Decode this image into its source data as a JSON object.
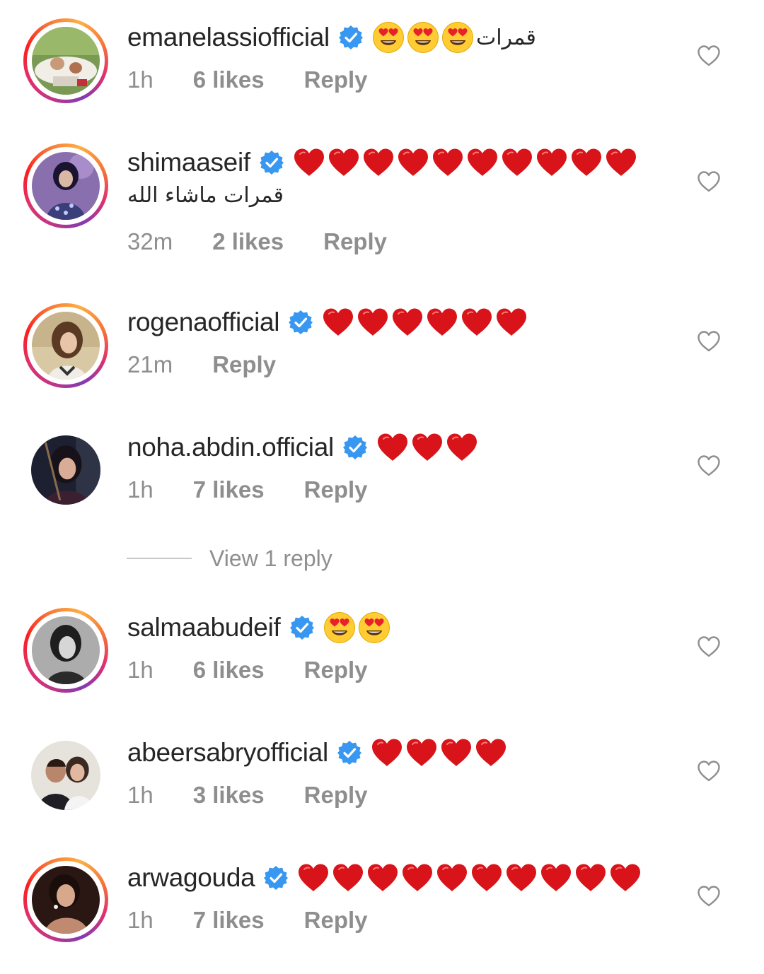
{
  "colors": {
    "heart_red": "#d8141a",
    "verified_blue": "#3897f0",
    "meta_gray": "#8e8e8e",
    "text_dark": "#262626"
  },
  "icons": {
    "verified": "verified-badge-icon",
    "like": "heart-outline-icon",
    "heart_emoji": "red-heart-emoji",
    "face_emoji": "heart-eyes-emoji"
  },
  "comments": [
    {
      "username": "emanelassiofficial",
      "verified": true,
      "text": "قمرات",
      "emoji": "heart-eyes-emoji",
      "emoji_count": 3,
      "time": "1h",
      "likes": "6 likes",
      "reply": "Reply"
    },
    {
      "username": "shimaaseif",
      "verified": true,
      "text": "قمرات ماشاء الله",
      "emoji": "red-heart-emoji",
      "emoji_count": 10,
      "time": "32m",
      "likes": "2 likes",
      "reply": "Reply"
    },
    {
      "username": "rogenaofficial",
      "verified": true,
      "emoji": "red-heart-emoji",
      "emoji_count": 6,
      "time": "21m",
      "reply": "Reply"
    },
    {
      "username": "noha.abdin.official",
      "verified": true,
      "emoji": "red-heart-emoji",
      "emoji_count": 3,
      "time": "1h",
      "likes": "7 likes",
      "reply": "Reply"
    },
    {
      "username": "salmaabudeif",
      "verified": true,
      "emoji": "heart-eyes-emoji",
      "emoji_count": 2,
      "time": "1h",
      "likes": "6 likes",
      "reply": "Reply"
    },
    {
      "username": "abeersabryofficial",
      "verified": true,
      "emoji": "red-heart-emoji",
      "emoji_count": 4,
      "time": "1h",
      "likes": "3 likes",
      "reply": "Reply"
    },
    {
      "username": "arwagouda",
      "verified": true,
      "emoji": "red-heart-emoji",
      "emoji_count": 10,
      "time": "1h",
      "likes": "7 likes",
      "reply": "Reply"
    }
  ],
  "view_replies": "View 1 reply"
}
